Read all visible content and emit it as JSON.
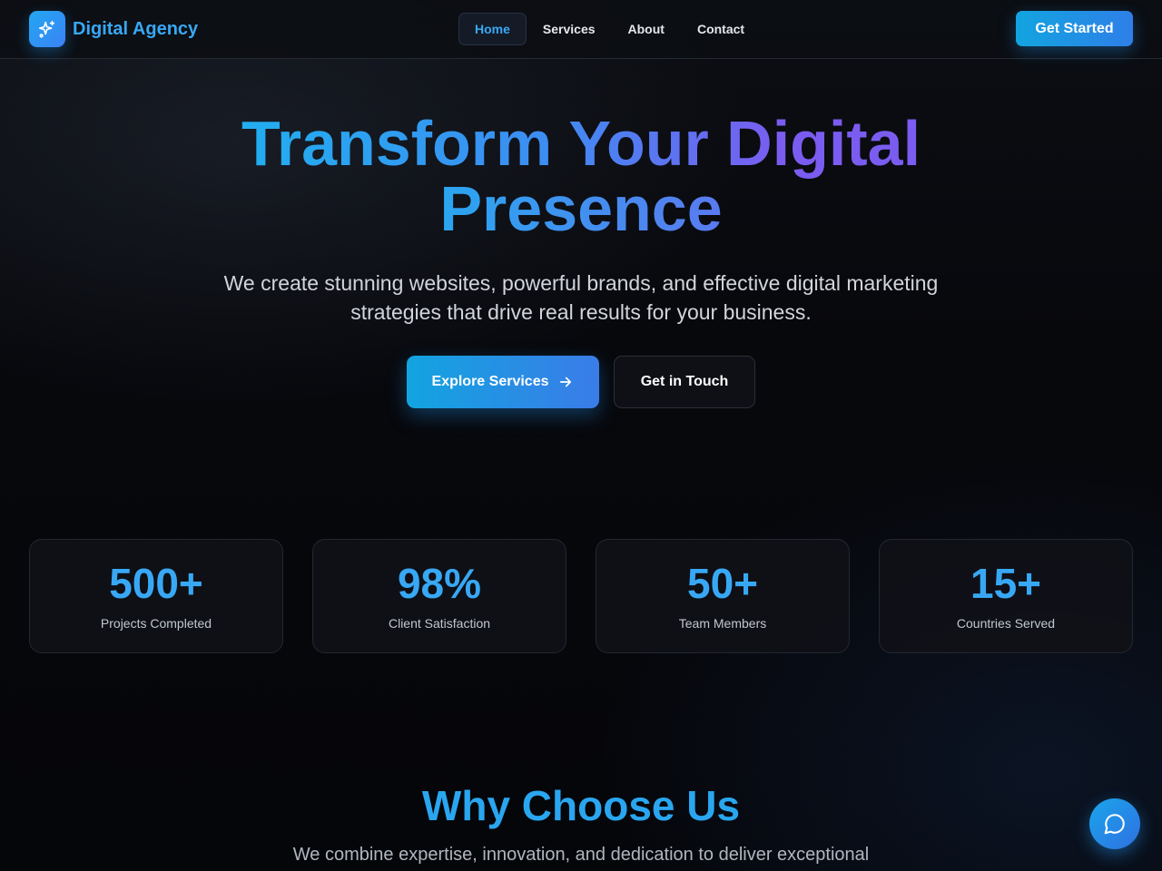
{
  "brand": {
    "name": "Digital Agency",
    "icon": "sparkles-icon"
  },
  "nav": {
    "links": [
      {
        "label": "Home",
        "active": true
      },
      {
        "label": "Services",
        "active": false
      },
      {
        "label": "About",
        "active": false
      },
      {
        "label": "Contact",
        "active": false
      }
    ],
    "cta_label": "Get Started"
  },
  "hero": {
    "title_line1": "Transform Your Digital",
    "title_line2": "Presence",
    "subtitle": "We create stunning websites, powerful brands, and effective digital marketing strategies that drive real results for your business.",
    "primary_button": "Explore Services",
    "secondary_button": "Get in Touch"
  },
  "stats": [
    {
      "value": "500+",
      "label": "Projects Completed"
    },
    {
      "value": "98%",
      "label": "Client Satisfaction"
    },
    {
      "value": "50+",
      "label": "Team Members"
    },
    {
      "value": "15+",
      "label": "Countries Served"
    }
  ],
  "why": {
    "title": "Why Choose Us",
    "subtitle": "We combine expertise, innovation, and dedication to deliver exceptional"
  },
  "colors": {
    "accent": "#38a8f5",
    "gradient_end": "#7b5cf0",
    "background": "#05060a"
  },
  "chat": {
    "icon": "chat-bubble-icon"
  }
}
